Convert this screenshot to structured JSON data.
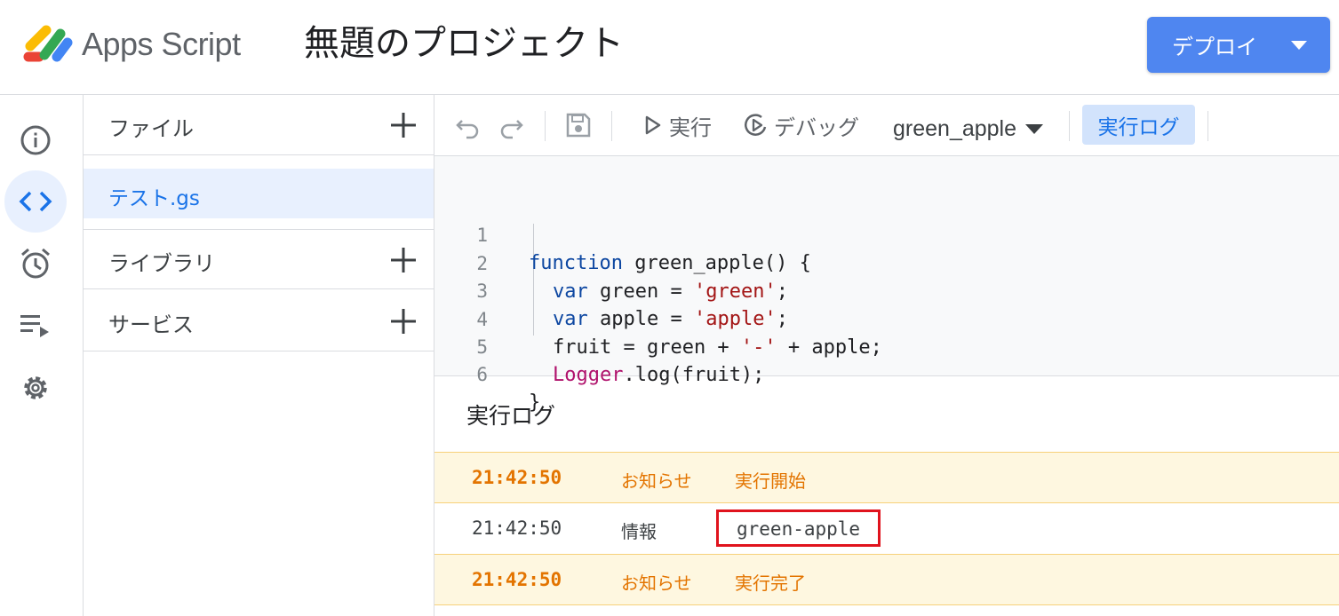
{
  "header": {
    "brand": "Apps Script",
    "project_title": "無題のプロジェクト",
    "deploy_label": "デプロイ"
  },
  "files_panel": {
    "files_label": "ファイル",
    "file_items": [
      "テスト.gs"
    ],
    "libraries_label": "ライブラリ",
    "services_label": "サービス"
  },
  "toolbar": {
    "run_label": "実行",
    "debug_label": "デバッグ",
    "function_name": "green_apple",
    "log_label": "実行ログ"
  },
  "editor": {
    "line_numbers": [
      "1",
      "2",
      "3",
      "4",
      "5",
      "6"
    ],
    "line1": {
      "kw": "function",
      "rest": " green_apple() {"
    },
    "line2": {
      "kw": "var",
      "mid": " green = ",
      "str": "'green'",
      "end": ";"
    },
    "line3": {
      "kw": "var",
      "mid": " apple = ",
      "str": "'apple'",
      "end": ";"
    },
    "line4": {
      "pre": "fruit = green + ",
      "str": "'-'",
      "end": " + apple;"
    },
    "line5": {
      "cls": "Logger",
      "end": ".log(fruit);"
    },
    "line6": {
      "text": "}"
    }
  },
  "log": {
    "title": "実行ログ",
    "entries": [
      {
        "time": "21:42:50",
        "level": "お知らせ",
        "message": "実行開始"
      },
      {
        "time": "21:42:50",
        "level": "情報",
        "message": "green-apple"
      },
      {
        "time": "21:42:50",
        "level": "お知らせ",
        "message": "実行完了"
      }
    ]
  },
  "colors": {
    "accent": "#1a73e8",
    "deploy_button": "#4f86f0",
    "notice_bg": "#fef7e0",
    "notice_text": "#e37400",
    "highlight_box": "#e0131d"
  }
}
